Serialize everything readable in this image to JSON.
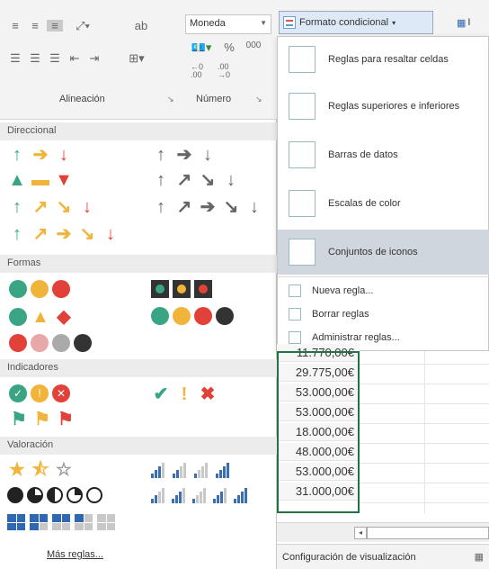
{
  "ribbon": {
    "alignment_label": "Alineación",
    "number_label": "Número",
    "number_format": "Moneda",
    "percent_symbol": "%",
    "thousands": "000",
    "conditional_format_label": "Formato condicional",
    "right_partial_label": "I"
  },
  "panel": {
    "sections": {
      "direccional": "Direccional",
      "formas": "Formas",
      "indicadores": "Indicadores",
      "valoracion": "Valoración"
    },
    "more_rules": "Más reglas..."
  },
  "menu": {
    "items": [
      "Reglas para resaltar celdas",
      "Reglas superiores e inferiores",
      "Barras de datos",
      "Escalas de color",
      "Conjuntos de iconos"
    ],
    "small_items": [
      "Nueva regla...",
      "Borrar reglas",
      "Administrar reglas..."
    ]
  },
  "sheet": {
    "cells": [
      "11.770,00€",
      "29.775,00€",
      "53.000,00€",
      "53.000,00€",
      "18.000,00€",
      "48.000,00€",
      "53.000,00€",
      "31.000,00€"
    ]
  },
  "status": {
    "label": "Configuración de visualización"
  },
  "colors": {
    "green": "#3aa585",
    "orange": "#f0b43a",
    "red": "#e2413a",
    "blue": "#2f67b0",
    "selected": "#cfd6de"
  }
}
